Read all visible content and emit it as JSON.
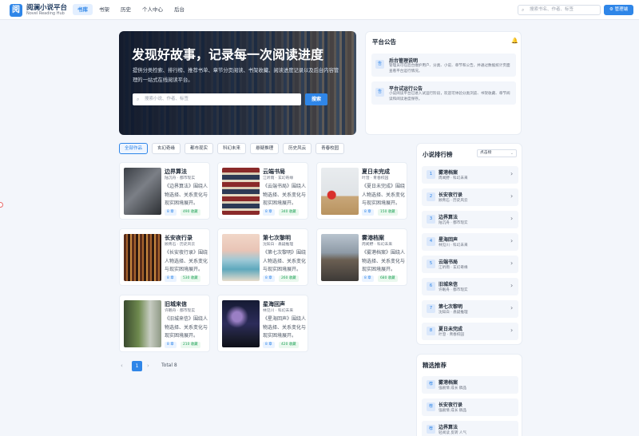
{
  "header": {
    "logo_char": "阅",
    "title": "阅澜小说平台",
    "subtitle": "Novel Reading Hub",
    "nav": [
      "书库",
      "书架",
      "历史",
      "个人中心",
      "后台"
    ],
    "search_placeholder": "搜索书名、作者、标签",
    "admin_button": "⚙ 管理端"
  },
  "hero": {
    "title": "发现好故事，记录每一次阅读进度",
    "description": "提供分类检索、排行榜、推荐书单、章节分页阅读、书架收藏、阅读进度记录以及后台内容管理的一站式在线阅读平台。",
    "search_placeholder": "搜索小说、作者、标签",
    "search_button": "搜索"
  },
  "notice": {
    "title": "平台公告",
    "items": [
      {
        "title": "后台管理说明",
        "desc": "管理员可在后台维护用户、分类、小说、章节和公告，并通过数据统计页面查看平台运行情况。"
      },
      {
        "title": "平台试运行公告",
        "desc": "小说阅读平台已进入试运行阶段，欢迎可体验分类浏览、书架收藏、章节阅读和阅读进度保存。"
      }
    ]
  },
  "filters": [
    "全部作品",
    "玄幻奇缘",
    "都市现实",
    "科幻未来",
    "悬疑推理",
    "历史风云",
    "青春校园"
  ],
  "books": [
    {
      "title": "边界算法",
      "meta": "陆沉舟 · 都市现实",
      "desc": "《边界算法》围绕人物选择、关系变化与现实困境展开。",
      "chapters": "8 章",
      "favs": "490 收藏"
    },
    {
      "title": "云端书局",
      "meta": "江听雨 · 玄幻奇缘",
      "desc": "《云端书局》围绕人物选择、关系变化与现实困境展开。",
      "chapters": "8 章",
      "favs": "340 收藏"
    },
    {
      "title": "夏日未完成",
      "meta": "叶澄 · 青春校园",
      "desc": "《夏日未完成》围绕人物选择、关系变化与现实困境展开。",
      "chapters": "8 章",
      "favs": "150 收藏"
    },
    {
      "title": "长安夜行录",
      "meta": "顾青石 · 历史风云",
      "desc": "《长安夜行录》围绕人物选择、关系变化与现实困境展开。",
      "chapters": "8 章",
      "favs": "530 收藏"
    },
    {
      "title": "第七次黎明",
      "meta": "沈知白 · 悬疑推理",
      "desc": "《第七次黎明》围绕人物选择、关系变化与现实困境展开。",
      "chapters": "8 章",
      "favs": "260 收藏"
    },
    {
      "title": "雾港档案",
      "meta": "周闻野 · 科幻未来",
      "desc": "《雾港档案》围绕人物选择、关系变化与现实困境展开。",
      "chapters": "8 章",
      "favs": "680 收藏"
    },
    {
      "title": "旧城来信",
      "meta": "许眠舟 · 都市现实",
      "desc": "《旧城来信》围绕人物选择、关系变化与现实困境展开。",
      "chapters": "8 章",
      "favs": "210 收藏"
    },
    {
      "title": "星海回声",
      "meta": "林见川 · 科幻未来",
      "desc": "《星海回声》围绕人物选择、关系变化与现实困境展开。",
      "chapters": "8 章",
      "favs": "420 收藏"
    }
  ],
  "pager": {
    "prev": "‹",
    "current": "1",
    "next": "›",
    "total": "Total 8"
  },
  "ranking": {
    "title": "小说排行榜",
    "select_value": "点击榜",
    "items": [
      {
        "num": "1",
        "title": "雾港档案",
        "meta": "周闻野 · 科幻未来"
      },
      {
        "num": "2",
        "title": "长安夜行录",
        "meta": "顾青石 · 历史风云"
      },
      {
        "num": "3",
        "title": "边界算法",
        "meta": "陆沉舟 · 都市现实"
      },
      {
        "num": "4",
        "title": "星海回声",
        "meta": "林见川 · 科幻未来"
      },
      {
        "num": "5",
        "title": "云端书局",
        "meta": "江听雨 · 玄幻奇缘"
      },
      {
        "num": "6",
        "title": "旧城来信",
        "meta": "许眠舟 · 都市现实"
      },
      {
        "num": "7",
        "title": "第七次黎明",
        "meta": "沈知白 · 悬疑推理"
      },
      {
        "num": "8",
        "title": "夏日未完成",
        "meta": "叶澄 · 青春校园"
      }
    ]
  },
  "picks": {
    "title": "精选推荐",
    "items": [
      {
        "title": "雾港档案",
        "meta": "强剧情 成长 稿品"
      },
      {
        "title": "长安夜行录",
        "meta": "强剧情 成长 稿品"
      },
      {
        "title": "边界算法",
        "meta": "轻阅读 反转 人气"
      }
    ]
  }
}
